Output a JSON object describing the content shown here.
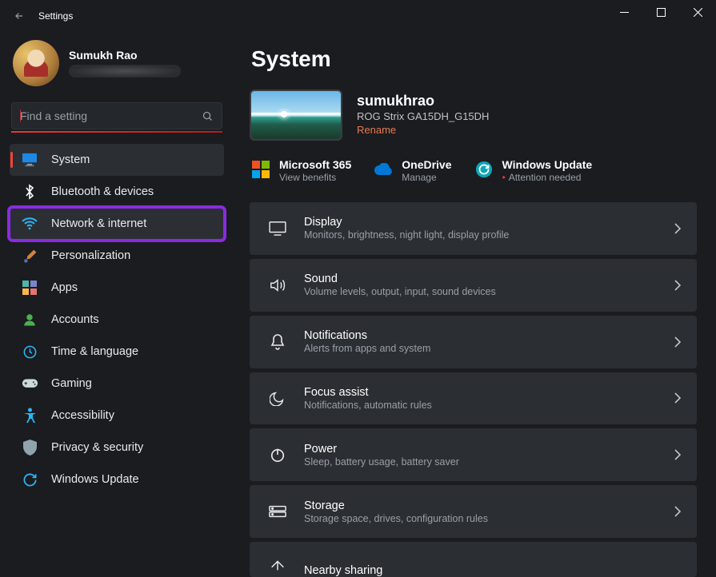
{
  "window": {
    "title": "Settings"
  },
  "user": {
    "name": "Sumukh Rao"
  },
  "search": {
    "placeholder": "Find a setting"
  },
  "sidebar": {
    "items": [
      {
        "label": "System",
        "icon": "monitor",
        "selected": true
      },
      {
        "label": "Bluetooth & devices",
        "icon": "bluetooth"
      },
      {
        "label": "Network & internet",
        "icon": "wifi",
        "highlighted": true
      },
      {
        "label": "Personalization",
        "icon": "brush"
      },
      {
        "label": "Apps",
        "icon": "apps"
      },
      {
        "label": "Accounts",
        "icon": "accounts"
      },
      {
        "label": "Time & language",
        "icon": "clock"
      },
      {
        "label": "Gaming",
        "icon": "gaming"
      },
      {
        "label": "Accessibility",
        "icon": "accessibility"
      },
      {
        "label": "Privacy & security",
        "icon": "shield"
      },
      {
        "label": "Windows Update",
        "icon": "update"
      }
    ]
  },
  "page": {
    "title": "System"
  },
  "device": {
    "name": "sumukhrao",
    "model": "ROG Strix GA15DH_G15DH",
    "rename": "Rename"
  },
  "actions": {
    "ms365": {
      "label": "Microsoft 365",
      "desc": "View benefits"
    },
    "onedrive": {
      "label": "OneDrive",
      "desc": "Manage"
    },
    "winupdate": {
      "label": "Windows Update",
      "desc": "Attention needed"
    }
  },
  "rows": [
    {
      "title": "Display",
      "desc": "Monitors, brightness, night light, display profile",
      "icon": "display"
    },
    {
      "title": "Sound",
      "desc": "Volume levels, output, input, sound devices",
      "icon": "sound"
    },
    {
      "title": "Notifications",
      "desc": "Alerts from apps and system",
      "icon": "bell"
    },
    {
      "title": "Focus assist",
      "desc": "Notifications, automatic rules",
      "icon": "moon"
    },
    {
      "title": "Power",
      "desc": "Sleep, battery usage, battery saver",
      "icon": "power"
    },
    {
      "title": "Storage",
      "desc": "Storage space, drives, configuration rules",
      "icon": "storage"
    },
    {
      "title": "Nearby sharing",
      "desc": "",
      "icon": "share"
    }
  ],
  "colors": {
    "accent": "#f44336",
    "highlight": "#8a2be2",
    "link": "#e57b52"
  }
}
